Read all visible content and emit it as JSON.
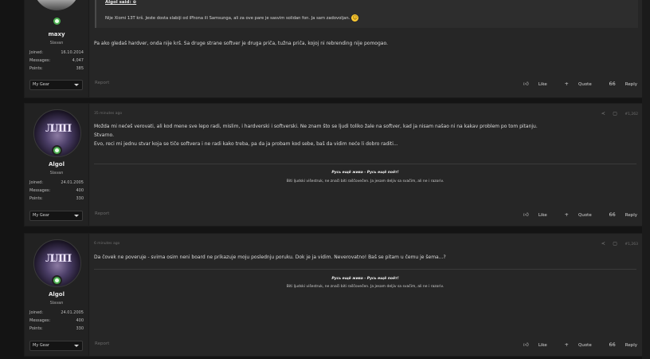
{
  "posts": [
    {
      "user": {
        "name": "maxy",
        "title": "Slavan",
        "joined_label": "Joined:",
        "joined": "16.10.2014",
        "messages_label": "Messages:",
        "messages": "4,047",
        "points_label": "Points:",
        "points": "385"
      },
      "quote": {
        "author": "Algol said:",
        "text": "Nije Xiomi 13T krš. Jeste dosta slabiji od iPhona ili Samsunga, ali za ove pare je sasvim solidan fon. Ja sam zadovoljan."
      },
      "body": [
        "Pa ako gledaš hardver, onda nije krš. Sa druge strane softver je druga priča, tužna priča, kojoj ni rebrending nije pomogao."
      ],
      "gear_label": "My Gear",
      "report": "Report",
      "like": "Like",
      "quote_btn": "Quote",
      "reply": "Reply"
    },
    {
      "user": {
        "name": "Algol",
        "title": "Slavan",
        "joined_label": "Joined:",
        "joined": "24.01.2005",
        "messages_label": "Messages:",
        "messages": "400",
        "points_label": "Points:",
        "points": "330"
      },
      "time": "35 minutes ago",
      "number": "#1,262",
      "body": [
        "Možda mi nećeš verovati, ali kod mene sve lepo radi, mislim, i hardverski i softverski. Ne znam što se ljudi toliko žale na softver, kad ja nisam našao ni na kakav problem po tom pitanju.",
        "Stvarno.",
        "Evo, reci mi jednu stvar koja se tiče softvera i ne radi kako treba, pa da ja probam kod sebe, baš da vidim neće li dobro raditi..."
      ],
      "sig1": "Русь ещё жива - Русь ещё поёт!",
      "sig2": "Biti ljudski višestruk, ne znači biti raščovečen. Ja jesam deljiv sa svačim, ali ne i razoriv.",
      "gear_label": "My Gear",
      "report": "Report",
      "like": "Like",
      "quote_btn": "Quote",
      "reply": "Reply"
    },
    {
      "user": {
        "name": "Algol",
        "title": "Slavan",
        "joined_label": "Joined:",
        "joined": "24.01.2005",
        "messages_label": "Messages:",
        "messages": "400",
        "points_label": "Points:",
        "points": "330"
      },
      "time": "6 minutes ago",
      "number": "#1,263",
      "body": [
        "Da čovek ne poveruje - svima osim neni board ne prikazuje moju poslednju poruku. Dok je ja vidim. Neverovatno! Baš se pitam u čemu je šema...?"
      ],
      "sig1": "Русь ещё жива - Русь ещё поёт!",
      "sig2": "Biti ljudski višestruk, ne znači biti raščovečen. Ja jesam deljiv sa svačim, ali ne i razoriv.",
      "gear_label": "My Gear",
      "report": "Report",
      "like": "Like",
      "quote_btn": "Quote",
      "reply": "Reply"
    }
  ],
  "icons": {
    "share": "share-icon",
    "bookmark": "bookmark-icon",
    "like": "thumbs-up-icon",
    "quote": "plus-icon",
    "reply": "reply-quote-icon"
  }
}
